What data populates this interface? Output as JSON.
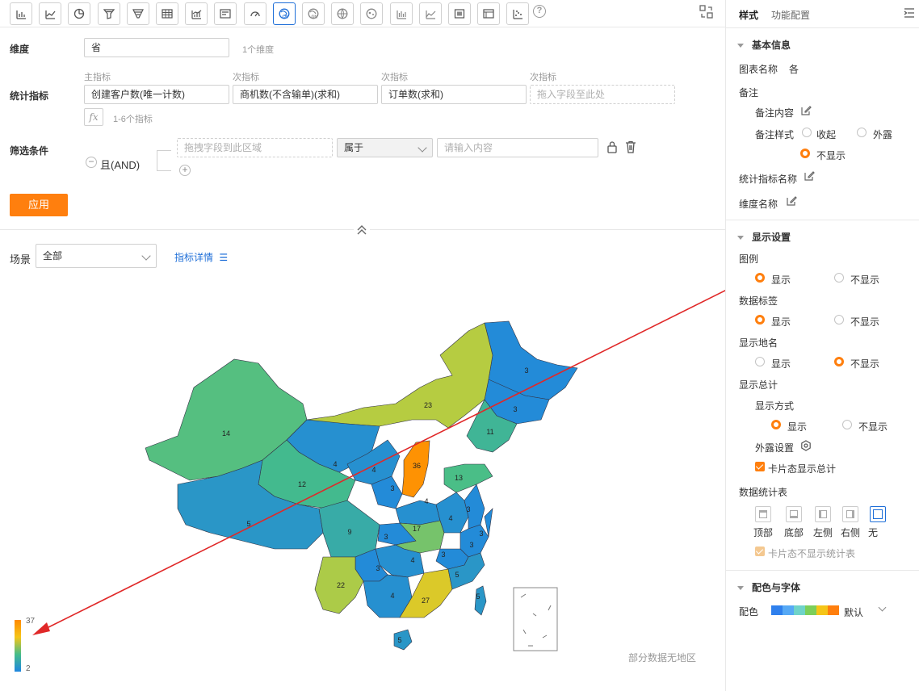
{
  "toolbar": {
    "icons": [
      "bar-chart-icon",
      "line-chart-icon",
      "pie-chart-icon",
      "funnel-icon",
      "funnel-alt-icon",
      "table-icon",
      "combo-chart-icon",
      "card-icon",
      "gauge-icon",
      "china-map-icon",
      "globe-map-icon",
      "world-map-icon",
      "bubble-map-icon",
      "column-chart-icon",
      "area-chart-icon",
      "image-icon",
      "detail-table-icon",
      "scatter-icon"
    ],
    "active_index": 9
  },
  "filters": {
    "dimension_label": "维度",
    "dimension_value": "省",
    "dimension_hint": "1个维度",
    "metric_label": "统计指标",
    "metric_headers": [
      "主指标",
      "次指标",
      "次指标",
      "次指标"
    ],
    "metric_values": [
      "创建客户数(唯一计数)",
      "商机数(不含输单)(求和)",
      "订单数(求和)"
    ],
    "metric_placeholder": "拖入字段至此处",
    "metric_hint": "1-6个指标",
    "fx_label": "fx",
    "condition_label": "筛选条件",
    "logic_label": "且(AND)",
    "field_placeholder": "拖拽字段到此区域",
    "operator": "属于",
    "value_placeholder": "请输入内容",
    "apply_label": "应用"
  },
  "scene": {
    "label": "场景",
    "value": "全部",
    "detail_link": "指标详情"
  },
  "map": {
    "legend_max": "37",
    "legend_min": "2",
    "no_region_note": "部分数据无地区",
    "colors": {
      "low": "#1f86e0",
      "mid": "#45bd8a",
      "high": "#ff8a00"
    }
  },
  "chart_data": {
    "type": "heatmap",
    "title": "",
    "legend_range": [
      2,
      37
    ],
    "regions": [
      {
        "label": "3",
        "value": 3
      },
      {
        "label": "3",
        "value": 3
      },
      {
        "label": "23",
        "value": 23
      },
      {
        "label": "11",
        "value": 11
      },
      {
        "label": "14",
        "value": 14
      },
      {
        "label": "4",
        "value": 4
      },
      {
        "label": "4",
        "value": 4
      },
      {
        "label": "36",
        "value": 36
      },
      {
        "label": "13",
        "value": 13
      },
      {
        "label": "12",
        "value": 12
      },
      {
        "label": "3",
        "value": 3
      },
      {
        "label": "5",
        "value": 5
      },
      {
        "label": "9",
        "value": 9
      },
      {
        "label": "4",
        "value": 4
      },
      {
        "label": "4",
        "value": 4
      },
      {
        "label": "3",
        "value": 3
      },
      {
        "label": "3",
        "value": 3
      },
      {
        "label": "17",
        "value": 17
      },
      {
        "label": "3",
        "value": 3
      },
      {
        "label": "4",
        "value": 4
      },
      {
        "label": "3",
        "value": 3
      },
      {
        "label": "3",
        "value": 3
      },
      {
        "label": "22",
        "value": 22
      },
      {
        "label": "4",
        "value": 4
      },
      {
        "label": "27",
        "value": 27
      },
      {
        "label": "5",
        "value": 5
      },
      {
        "label": "5",
        "value": 5
      },
      {
        "label": "5",
        "value": 5
      },
      {
        "label": "3",
        "value": 3
      }
    ]
  },
  "sidebar": {
    "tab_style": "样式",
    "tab_config": "功能配置",
    "basic_section": "基本信息",
    "chart_name_label": "图表名称",
    "chart_name_value": "各",
    "note_label": "备注",
    "note_content_label": "备注内容",
    "note_style_label": "备注样式",
    "note_opt_collapse": "收起",
    "note_opt_expose": "外露",
    "note_opt_hide": "不显示",
    "metric_name_label": "统计指标名称",
    "dimension_name_label": "维度名称",
    "display_section": "显示设置",
    "legend_label": "图例",
    "data_label_label": "数据标签",
    "place_name_label": "显示地名",
    "total_label": "显示总计",
    "total_mode_label": "显示方式",
    "opt_show": "显示",
    "opt_hide": "不显示",
    "expose_setting_label": "外露设置",
    "card_total_label": "卡片态显示总计",
    "stat_table_label": "数据统计表",
    "stat_positions": [
      "顶部",
      "底部",
      "左侧",
      "右侧",
      "无"
    ],
    "card_no_table_label": "卡片态不显示统计表",
    "color_section": "配色与字体",
    "palette_label": "配色",
    "palette_value": "默认",
    "palette_colors": [
      "#2f80ed",
      "#56a9f5",
      "#6fd3c9",
      "#7ccf5a",
      "#f5c518",
      "#ff7f0e"
    ]
  }
}
